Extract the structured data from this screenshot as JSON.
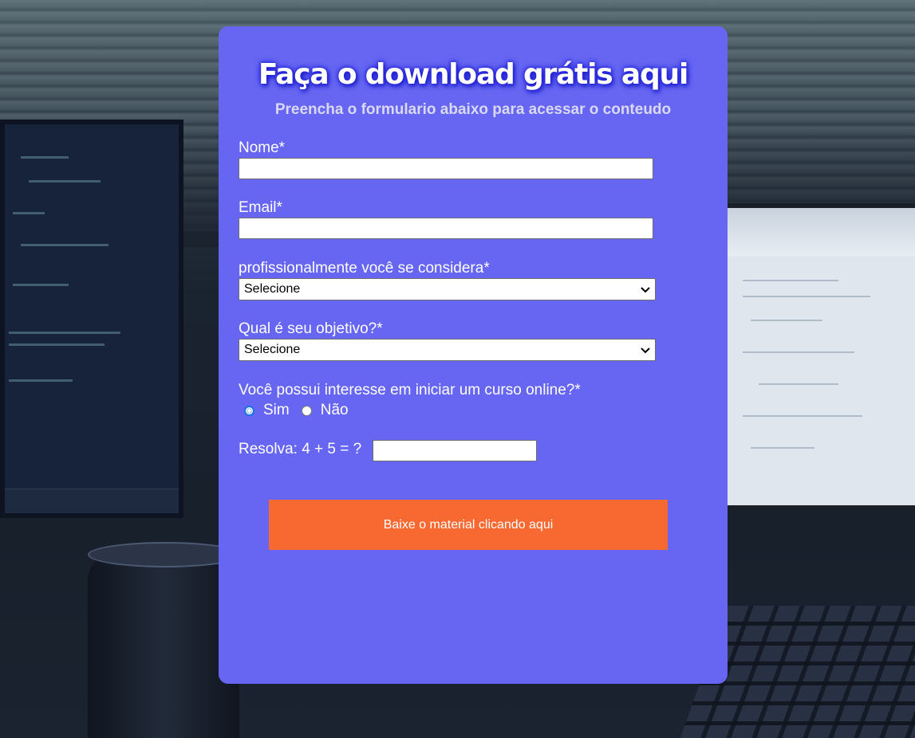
{
  "form": {
    "title": "Faça o download grátis aqui",
    "subtitle": "Preencha o formulario abaixo para acessar o conteudo",
    "fields": {
      "name": {
        "label": "Nome*",
        "value": ""
      },
      "email": {
        "label": "Email*",
        "value": ""
      },
      "profession": {
        "label": "profissionalmente você se considera*",
        "selected": "Selecione"
      },
      "goal": {
        "label": "Qual é seu objetivo?*",
        "selected": "Selecione"
      },
      "course_interest": {
        "label": "Você possui interesse em iniciar um curso online?*",
        "options": [
          "Sim",
          "Não"
        ],
        "selected": "Sim"
      },
      "captcha": {
        "label": "Resolva: 4 + 5 = ?",
        "value": ""
      }
    },
    "submit_label": "Baixe o material clicando aqui"
  },
  "colors": {
    "card": "#6666f2",
    "button": "#f76931",
    "title_glow": "#1c1cd8",
    "radio_checked": "#1a73e8"
  }
}
